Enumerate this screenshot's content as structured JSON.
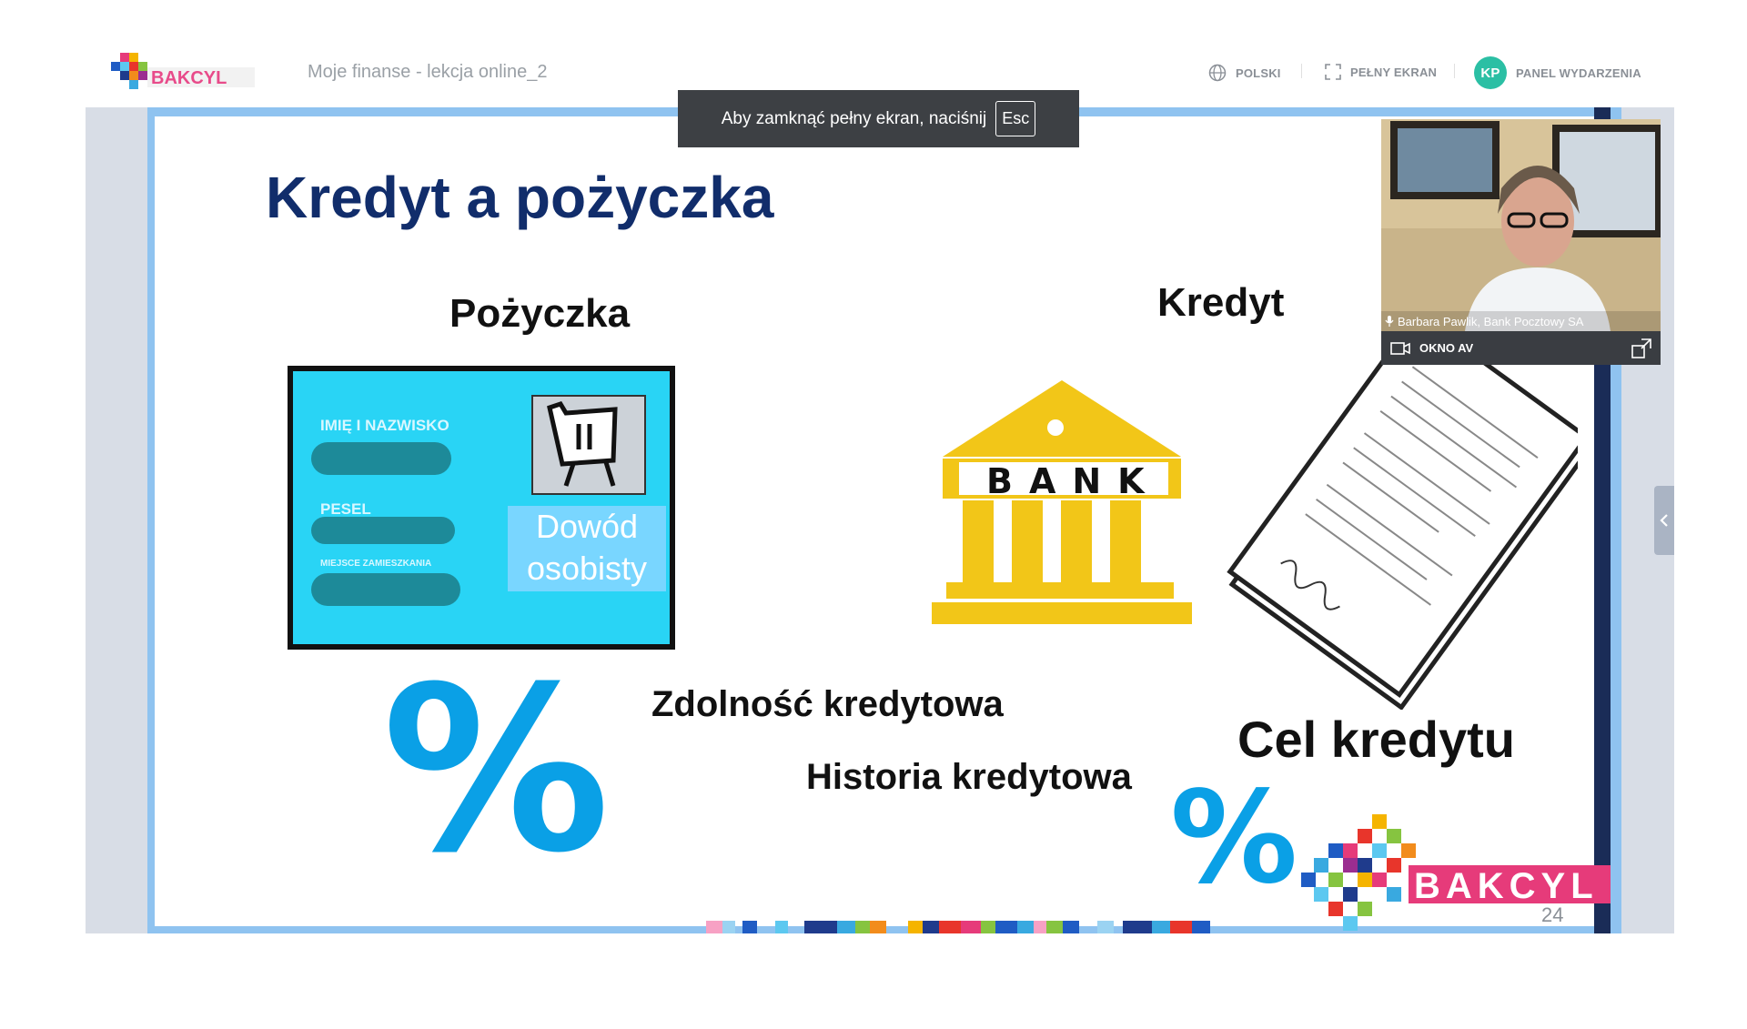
{
  "header": {
    "logo_text": "BAKCYL",
    "event_title": "Moje finanse - lekcja online_2",
    "language_label": "POLSKI",
    "fullscreen_label": "PEŁNY EKRAN",
    "avatar_initials": "KP",
    "panel_label": "PANEL WYDARZENIA"
  },
  "fullscreen_notice": {
    "text": "Aby zamknąć pełny ekran, naciśnij",
    "key": "Esc"
  },
  "slide": {
    "title": "Kredyt a pożyczka",
    "pozyczka": "Pożyczka",
    "kredyt": "Kredyt",
    "id_card": {
      "name_label": "IMIĘ I NAZWISKO",
      "pesel_label": "PESEL",
      "address_label": "MIEJSCE ZAMIESZKANIA",
      "doc_label_line1": "Dowód",
      "doc_label_line2": "osobisty"
    },
    "bank_label": "BANK",
    "zdolnosc": "Zdolność kredytowa",
    "historia": "Historia kredytowa",
    "cel": "Cel kredytu",
    "percent": "%",
    "footer_logo": "BAKCYL",
    "page_number": "24"
  },
  "av_window": {
    "speaker": "Barbara Pawlik, Bank Pocztowy SA",
    "label": "OKNO AV"
  },
  "colors": {
    "accent_teal": "#2bbfa4",
    "slide_title": "#112d6b",
    "percent_blue": "#0aa0e6",
    "id_card_cyan": "#29d4f5",
    "bank_yellow": "#f2c618"
  }
}
